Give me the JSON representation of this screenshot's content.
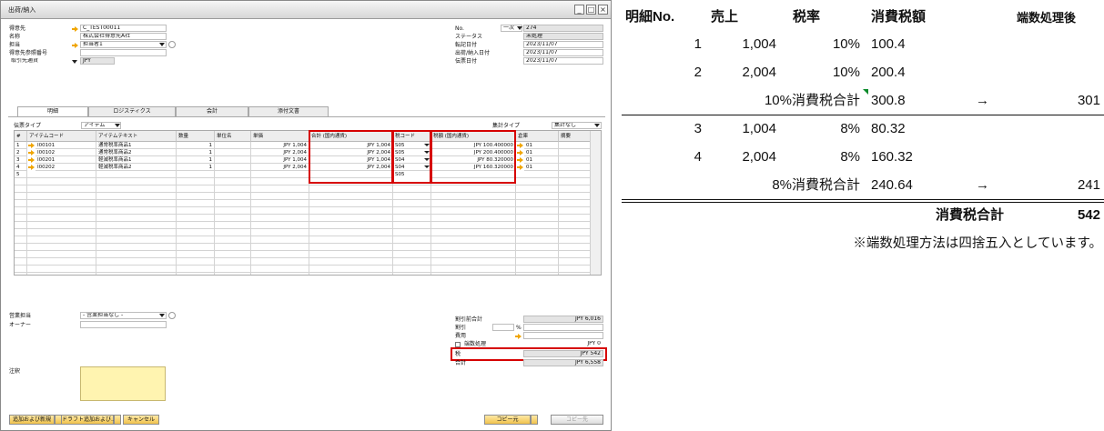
{
  "window": {
    "title": "出荷/納入",
    "buttons": {
      "minimize": "_",
      "restore": "□",
      "close": "×"
    }
  },
  "header_left": {
    "customer": {
      "label": "得意先",
      "value": "C_TEST00011"
    },
    "name": {
      "label": "名称",
      "value": "株式会社得意先A社"
    },
    "contact": {
      "label": "担当",
      "value": "担当者1"
    },
    "ref_no": {
      "label": "得意先参照番号",
      "value": ""
    },
    "currency": {
      "label": "取引先通貨",
      "value": "JPY"
    }
  },
  "header_right": {
    "no": {
      "label": "No.",
      "series": "一次",
      "value": "274"
    },
    "status": {
      "label": "ステータス",
      "value": "未処理"
    },
    "posting_date": {
      "label": "転記日付",
      "value": "2023/11/07"
    },
    "delivery_date": {
      "label": "出荷/納入日付",
      "value": "2023/11/07"
    },
    "document_date": {
      "label": "伝票日付",
      "value": "2023/11/07"
    }
  },
  "tabs": [
    {
      "label": "明細",
      "active": true
    },
    {
      "label": "ロジスティクス",
      "active": false
    },
    {
      "label": "会計",
      "active": false
    },
    {
      "label": "添付文書",
      "active": false
    }
  ],
  "doc_type": {
    "label": "伝票タイプ",
    "value": "アイテム"
  },
  "summary_type": {
    "label": "集計タイプ",
    "value": "集計なし"
  },
  "grid": {
    "columns": [
      "#",
      "アイテムコード",
      "アイテムテキスト",
      "数量",
      "単位名",
      "単価",
      "合計 (国内通貨)",
      "税コード",
      "税額 (国内通貨)",
      "倉庫",
      "摘要"
    ],
    "rows": [
      {
        "no": "1",
        "code": "I00101",
        "text": "通常税率商品1",
        "qty": "1",
        "unit": "",
        "price": "JPY 1,004",
        "total": "JPY 1,004",
        "tax": "S05",
        "taxamt": "JPY 100.400000",
        "wh": "01"
      },
      {
        "no": "2",
        "code": "I00102",
        "text": "通常税率商品2",
        "qty": "1",
        "unit": "",
        "price": "JPY 2,004",
        "total": "JPY 2,004",
        "tax": "S05",
        "taxamt": "JPY 200.400000",
        "wh": "01"
      },
      {
        "no": "3",
        "code": "I00201",
        "text": "軽減税率商品1",
        "qty": "1",
        "unit": "",
        "price": "JPY 1,004",
        "total": "JPY 1,004",
        "tax": "S04",
        "taxamt": "JPY 80.320000",
        "wh": "01"
      },
      {
        "no": "4",
        "code": "I00202",
        "text": "軽減税率商品2",
        "qty": "1",
        "unit": "",
        "price": "JPY 2,004",
        "total": "JPY 2,004",
        "tax": "S04",
        "taxamt": "JPY 160.320000",
        "wh": "01"
      }
    ],
    "new_row_no": "5",
    "new_row_tax": "S05"
  },
  "footer_left": {
    "sales_rep": {
      "label": "営業担当",
      "value": "- 営業担当なし -"
    },
    "owner": {
      "label": "オーナー",
      "value": ""
    },
    "remarks": {
      "label": "注釈",
      "value": ""
    }
  },
  "footer_right": {
    "before_discount": {
      "label": "割引前合計",
      "value": "JPY 6,016"
    },
    "discount": {
      "label": "割引",
      "unit": "%",
      "value": ""
    },
    "freight": {
      "label": "費用",
      "value": ""
    },
    "rounding": {
      "label": "端数処理",
      "value": "JPY 0"
    },
    "tax": {
      "label": "税",
      "value": "JPY 542"
    },
    "total": {
      "label": "合計",
      "value": "JPY 6,558"
    }
  },
  "buttons": {
    "add_new": "追加および新規",
    "draft": "ドラフト追加および…",
    "cancel": "キャンセル",
    "copy_from": "コピー元",
    "copy_to": "コピー先"
  },
  "calc": {
    "headers": [
      "明細No.",
      "売上",
      "税率",
      "消費税額",
      "端数処理後"
    ],
    "groups": [
      {
        "rows": [
          {
            "no": "1",
            "sales": "1,004",
            "rate": "10%",
            "tax": "100.4"
          },
          {
            "no": "2",
            "sales": "2,004",
            "rate": "10%",
            "tax": "200.4"
          }
        ],
        "subtotal_label": "10%消費税合計",
        "subtotal": "300.8",
        "arrow": "→",
        "rounded": "301"
      },
      {
        "rows": [
          {
            "no": "3",
            "sales": "1,004",
            "rate": "8%",
            "tax": "80.32"
          },
          {
            "no": "4",
            "sales": "2,004",
            "rate": "8%",
            "tax": "160.32"
          }
        ],
        "subtotal_label": "8%消費税合計",
        "subtotal": "240.64",
        "arrow": "→",
        "rounded": "241"
      }
    ],
    "grand_label": "消費税合計",
    "grand_value": "542",
    "note": "※端数処理方法は四捨五入としています。"
  }
}
